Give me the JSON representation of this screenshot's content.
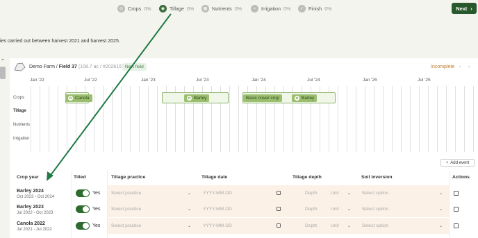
{
  "stepper": {
    "steps": [
      {
        "label": "Crops",
        "pct": "0%"
      },
      {
        "label": "Tillage",
        "pct": "0%"
      },
      {
        "label": "Nutrients",
        "pct": "0%"
      },
      {
        "label": "Irrigation",
        "pct": "0%"
      },
      {
        "label": "Finish",
        "pct": "0%"
      }
    ],
    "next_label": "Next"
  },
  "intro_text": "ies carried out between harvest 2021 and harvest 2025.",
  "farm": {
    "farm_name": "Demo Farm",
    "field_name": "Field 37",
    "field_meta": "(108.7 ac / #202615)",
    "badge": "New field",
    "status": "Incomplete"
  },
  "timeline": {
    "dates": [
      "Jan '22",
      "Jul '22",
      "Jan '23",
      "Jul '23",
      "Jan '24",
      "Jul '24",
      "Jan '25",
      "Jul '25"
    ],
    "rows": [
      "Crops",
      "Tillage",
      "Nutrients",
      "Irrigation"
    ],
    "crops": [
      "Canola",
      "Barley",
      "Basic cover crop",
      "Barley"
    ]
  },
  "add_event_label": "Add event",
  "table": {
    "headers": [
      "Crop year",
      "Tilled",
      "Tillage practice",
      "Tillage date",
      "Tillage depth",
      "Soil inversion",
      "Actions"
    ],
    "rows": [
      {
        "crop": "Barley 2024",
        "range": "Oct 2023 - Oct 2024",
        "tilled": "Yes"
      },
      {
        "crop": "Barley 2023",
        "range": "Jul 2022 - Oct 2023",
        "tilled": "Yes"
      },
      {
        "crop": "Canola 2022",
        "range": "Jul 2021 - Jul 2022",
        "tilled": "Yes"
      }
    ],
    "placeholders": {
      "practice": "Select practice",
      "date": "YYYY-MM-DD",
      "depth": "Depth",
      "unit": "Unit",
      "inversion": "Select option"
    }
  },
  "colors": {
    "accent": "#27592c",
    "arrow": "#1f7a44",
    "status": "#c07a2b",
    "row_highlight": "#fbf1e6"
  }
}
